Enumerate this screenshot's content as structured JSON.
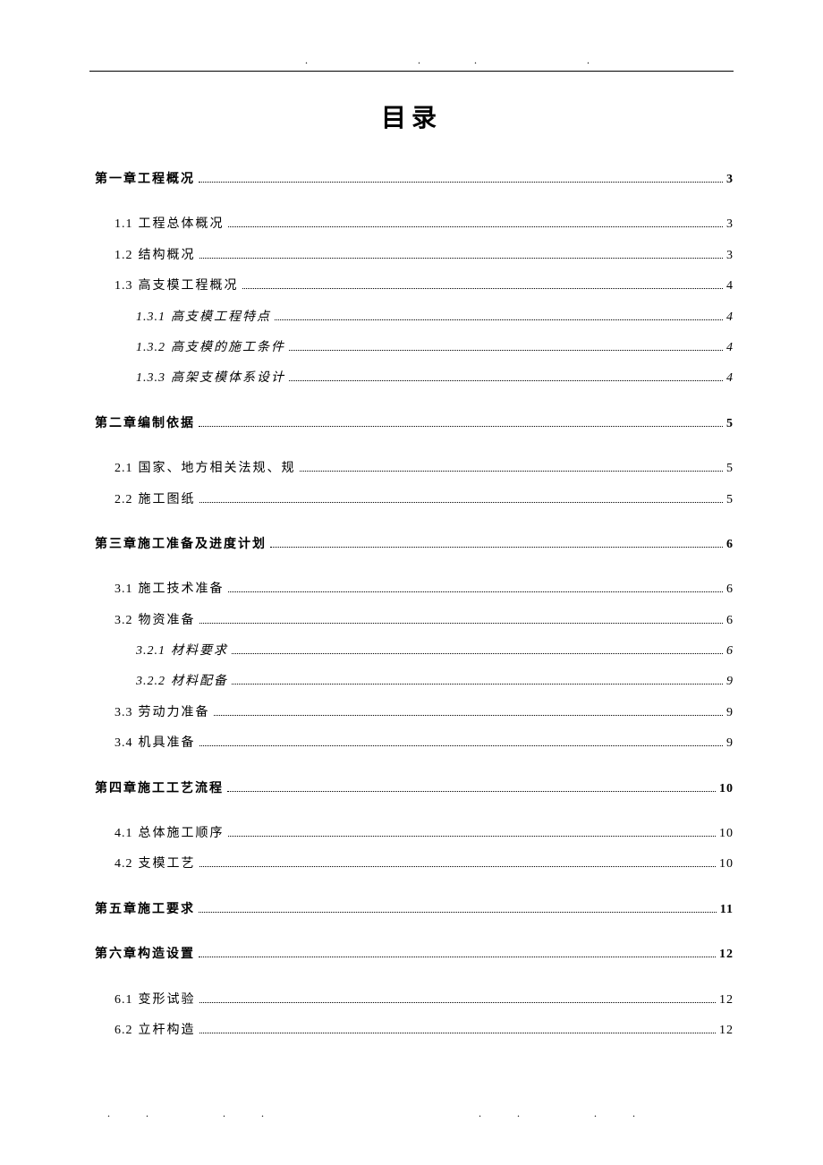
{
  "title": "目录",
  "header_marks": ". .. .",
  "footer_marks_left": ".. ..",
  "footer_marks_right": ".. ..",
  "toc": [
    {
      "level": 1,
      "num": "",
      "text": "第一章工程概况",
      "page": "3"
    },
    {
      "level": 2,
      "num": "1.1",
      "text": "工程总体概况",
      "page": "3"
    },
    {
      "level": 2,
      "num": "1.2",
      "text": "结构概况",
      "page": "3"
    },
    {
      "level": 2,
      "num": "1.3",
      "text": "高支模工程概况",
      "page": "4"
    },
    {
      "level": 3,
      "num": "1.3.1",
      "text": "高支模工程特点",
      "page": "4"
    },
    {
      "level": 3,
      "num": "1.3.2",
      "text": "高支模的施工条件",
      "page": "4"
    },
    {
      "level": 3,
      "num": "1.3.3",
      "text": "高架支模体系设计",
      "page": "4"
    },
    {
      "level": 1,
      "num": "",
      "text": "第二章编制依据",
      "page": "5"
    },
    {
      "level": 2,
      "num": "2.1",
      "text": "国家、地方相关法规、规",
      "page": "5"
    },
    {
      "level": 2,
      "num": "2.2",
      "text": "施工图纸",
      "page": "5"
    },
    {
      "level": 1,
      "num": "",
      "text": "第三章施工准备及进度计划",
      "page": "6"
    },
    {
      "level": 2,
      "num": "3.1",
      "text": "施工技术准备",
      "page": "6"
    },
    {
      "level": 2,
      "num": "3.2",
      "text": "物资准备",
      "page": "6"
    },
    {
      "level": 3,
      "num": "3.2.1",
      "text": "材料要求",
      "page": "6"
    },
    {
      "level": 3,
      "num": "3.2.2",
      "text": "材料配备",
      "page": "9"
    },
    {
      "level": 2,
      "num": "3.3",
      "text": "劳动力准备",
      "page": "9"
    },
    {
      "level": 2,
      "num": "3.4",
      "text": "机具准备",
      "page": "9"
    },
    {
      "level": 1,
      "num": "",
      "text": "第四章施工工艺流程",
      "page": "10"
    },
    {
      "level": 2,
      "num": "4.1",
      "text": "总体施工顺序",
      "page": "10"
    },
    {
      "level": 2,
      "num": "4.2",
      "text": "支模工艺",
      "page": "10"
    },
    {
      "level": 1,
      "num": "",
      "text": "第五章施工要求",
      "page": "11"
    },
    {
      "level": 1,
      "num": "",
      "text": "第六章构造设置",
      "page": "12"
    },
    {
      "level": 2,
      "num": "6.1",
      "text": "变形试验",
      "page": "12"
    },
    {
      "level": 2,
      "num": "6.2",
      "text": "立杆构造",
      "page": "12"
    }
  ]
}
